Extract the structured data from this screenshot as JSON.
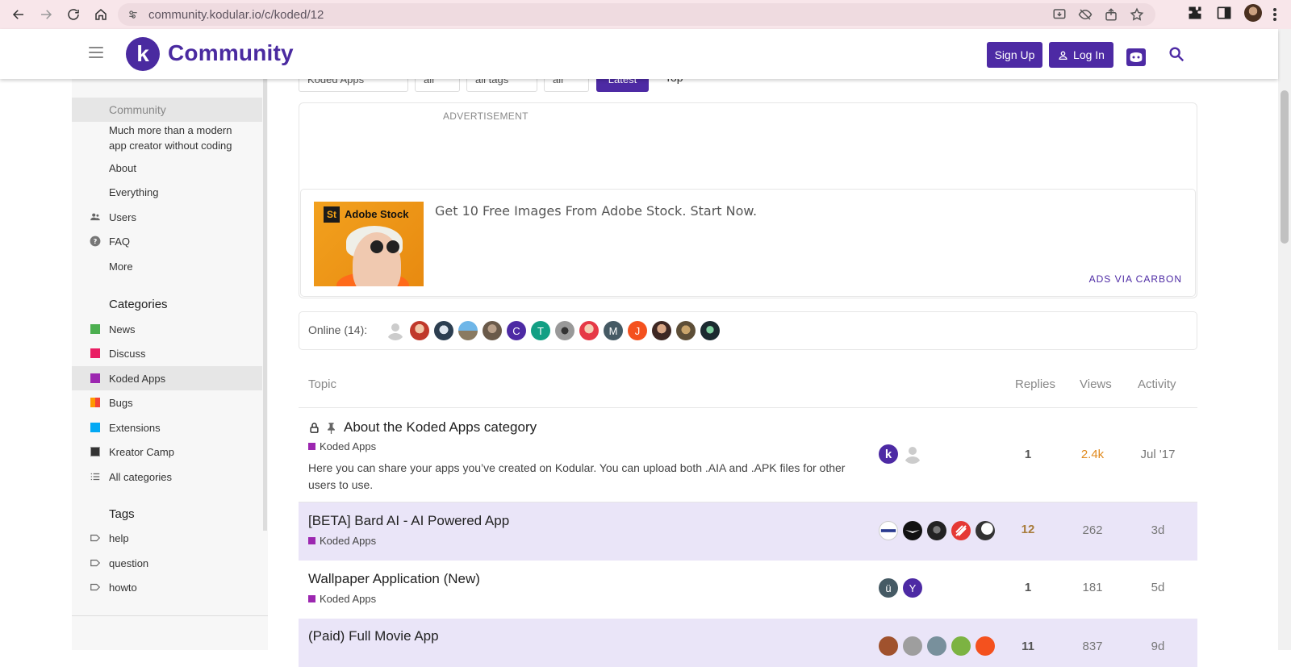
{
  "browser": {
    "url": "community.kodular.io/c/koded/12"
  },
  "header": {
    "logo_letter": "k",
    "site_name": "Community",
    "signup_label": "Sign Up",
    "login_label": "Log In"
  },
  "filters": {
    "items": [
      "Koded Apps",
      "all",
      "all tags",
      "all"
    ],
    "latest_label": "Latest",
    "top_label": "Top"
  },
  "sidebar": {
    "community_heading": "Community",
    "description": "Much more than a modern app creator without coding",
    "links": [
      "About",
      "Everything",
      "Users",
      "FAQ",
      "More"
    ],
    "categories_heading": "Categories",
    "categories": [
      {
        "name": "News",
        "color": "#4caf50"
      },
      {
        "name": "Discuss",
        "color": "#e91e63"
      },
      {
        "name": "Koded Apps",
        "color": "#9c27b0"
      },
      {
        "name": "Bugs",
        "color": "#ff9800"
      },
      {
        "name": "Extensions",
        "color": "#03a9f4"
      },
      {
        "name": "Kreator Camp",
        "color": "#333333"
      }
    ],
    "all_categories": "All categories",
    "tags_heading": "Tags",
    "tags": [
      "help",
      "question",
      "howto"
    ]
  },
  "ad": {
    "label": "ADVERTISEMENT",
    "brand_badge": "St",
    "brand_name": "Adobe Stock",
    "text": "Get 10 Free Images From Adobe Stock. Start Now.",
    "via": "ADS VIA CARBON"
  },
  "online": {
    "label": "Online (14):",
    "letters": [
      "C",
      "T",
      "M",
      "J"
    ]
  },
  "table": {
    "headers": {
      "topic": "Topic",
      "replies": "Replies",
      "views": "Views",
      "activity": "Activity"
    },
    "rows": [
      {
        "title": "About the Koded Apps category",
        "category": "Koded Apps",
        "excerpt": "Here you can share your apps you’ve created on Kodular. You can upload both .AIA and .APK files for other users to use.",
        "replies": "1",
        "views": "2.4k",
        "activity": "Jul '17"
      },
      {
        "title": "[BETA] Bard AI - AI Powered App",
        "category": "Koded Apps",
        "replies": "12",
        "views": "262",
        "activity": "3d"
      },
      {
        "title": "Wallpaper Application (New)",
        "category": "Koded Apps",
        "replies": "1",
        "views": "181",
        "activity": "5d",
        "poster_letters": [
          "ü",
          "Y"
        ]
      },
      {
        "title": "(Paid) Full Movie App",
        "replies": "11",
        "views": "837",
        "activity": "9d"
      }
    ]
  },
  "colors": {
    "brand": "#4d2aa4",
    "highlight_row": "#eae5f8",
    "views_hot": "#e08a1e",
    "replies_hot": "#a87c3b"
  }
}
